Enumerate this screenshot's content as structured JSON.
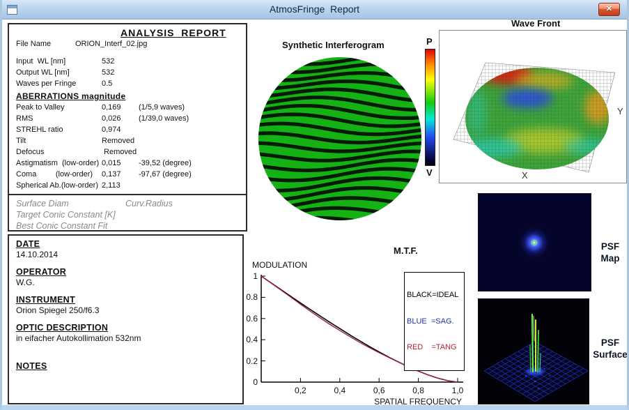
{
  "window": {
    "title": "AtmosFringe  Report",
    "close_glyph": "✕"
  },
  "report": {
    "title": "ANALYSIS  REPORT",
    "file": {
      "label": "File Name",
      "value": "ORION_Interf_02.jpg"
    },
    "params": [
      {
        "label": "Input  WL [nm]",
        "value": "532"
      },
      {
        "label": "Output WL [nm]",
        "value": "532"
      },
      {
        "label": "Waves per Fringe",
        "value": "0.5"
      }
    ],
    "aberrations": {
      "title": "ABERRATIONS magnitude",
      "rows": [
        {
          "label": "Peak to Valley",
          "value": "0,169",
          "extra": "(1/5,9 waves)"
        },
        {
          "label": "RMS",
          "value": "0,026",
          "extra": "(1/39,0 waves)"
        },
        {
          "label": "STREHL ratio",
          "value": "0,974",
          "extra": ""
        },
        {
          "label": "Tilt",
          "value": "Removed",
          "extra": ""
        },
        {
          "label": "Defocus",
          "value": " Removed",
          "extra": ""
        },
        {
          "label": "Astigmatism  (low-order)",
          "value": "0,015",
          "extra": "-39,52 (degree)"
        },
        {
          "label": "Coma         (low-order)",
          "value": "0,137",
          "extra": "-97,67 (degree)"
        },
        {
          "label": "Spherical Ab.(low-order)",
          "value": "2,113",
          "extra": ""
        }
      ]
    },
    "conic": {
      "surface_diam": "Surface Diam",
      "curv_radius": "Curv.Radius",
      "target_conic": "Target Conic Constant [K]",
      "best_conic": "Best Conic Constant Fit"
    }
  },
  "info": {
    "sections": [
      {
        "heading": "DATE",
        "text": "14.10.2014"
      },
      {
        "heading": "OPERATOR",
        "text": "W.G."
      },
      {
        "heading": "INSTRUMENT",
        "text": "Orion Spiegel 250/f6.3"
      },
      {
        "heading": "OPTIC DESCRIPTION",
        "text": "in eifacher Autokollimation 532nm"
      },
      {
        "heading": "NOTES",
        "text": ""
      }
    ]
  },
  "interferogram": {
    "title": "Synthetic Interferogram",
    "fringe_color": "#15b215",
    "line_color": "#041b04"
  },
  "colorbar": {
    "top": "P",
    "bottom": "V"
  },
  "wavefront": {
    "title": "Wave Front",
    "x_label": "X",
    "y_label": "Y"
  },
  "psf_map": {
    "label_line1": "PSF",
    "label_line2": "Map"
  },
  "psf_surface": {
    "label_line1": "PSF",
    "label_line2": "Surface"
  },
  "mtf": {
    "title": "M.T.F.",
    "y_axis_label": "MODULATION",
    "x_axis_label": "SPATIAL FREQUENCY",
    "legend": [
      {
        "text": "BLACK=IDEAL",
        "color": "#000000"
      },
      {
        "text": "BLUE  =SAG.",
        "color": "#2233aa"
      },
      {
        "text": "RED    =TANG",
        "color": "#bb2233"
      }
    ],
    "y_ticks": [
      "1",
      "0.8",
      "0.6",
      "0.4",
      "0.2",
      "0"
    ],
    "x_ticks": [
      "0,2",
      "0,4",
      "0,6",
      "0,8",
      "1,0"
    ]
  },
  "chart_data": {
    "type": "line",
    "title": "M.T.F.",
    "xlabel": "SPATIAL FREQUENCY",
    "ylabel": "MODULATION",
    "xlim": [
      0,
      1.0
    ],
    "ylim": [
      0,
      1
    ],
    "grid": false,
    "legend_position": "top-right",
    "x": [
      0,
      0.05,
      0.1,
      0.15,
      0.2,
      0.25,
      0.3,
      0.35,
      0.4,
      0.45,
      0.5,
      0.55,
      0.6,
      0.65,
      0.7,
      0.75,
      0.8,
      0.85,
      0.9,
      0.95,
      1.0
    ],
    "series": [
      {
        "name": "BLACK=IDEAL",
        "color": "#000000",
        "values": [
          1.0,
          0.936,
          0.873,
          0.81,
          0.747,
          0.685,
          0.624,
          0.564,
          0.505,
          0.447,
          0.391,
          0.337,
          0.285,
          0.235,
          0.188,
          0.144,
          0.104,
          0.068,
          0.037,
          0.013,
          0.0
        ]
      },
      {
        "name": "BLUE =SAG.",
        "color": "#2233aa",
        "values": [
          1.0,
          0.935,
          0.87,
          0.803,
          0.736,
          0.67,
          0.607,
          0.546,
          0.488,
          0.432,
          0.376,
          0.326,
          0.278,
          0.232,
          0.188,
          0.144,
          0.104,
          0.068,
          0.037,
          0.013,
          0.0
        ]
      },
      {
        "name": "RED =TANG",
        "color": "#bb2233",
        "values": [
          1.0,
          0.934,
          0.868,
          0.801,
          0.733,
          0.667,
          0.604,
          0.543,
          0.486,
          0.43,
          0.375,
          0.325,
          0.277,
          0.231,
          0.187,
          0.144,
          0.104,
          0.068,
          0.037,
          0.013,
          0.0
        ]
      }
    ]
  }
}
